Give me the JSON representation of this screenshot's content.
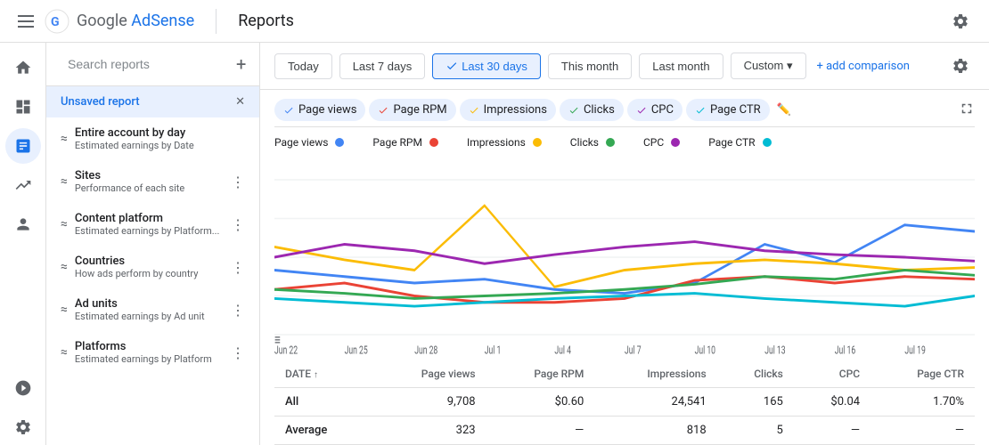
{
  "app": {
    "name": "Google AdSense",
    "logo_colors": [
      "#4285F4",
      "#EA4335",
      "#FBBC05",
      "#34A853"
    ],
    "page_title": "Reports"
  },
  "date_filters": {
    "options": [
      "Today",
      "Last 7 days",
      "Last 30 days",
      "This month",
      "Last month",
      "Custom"
    ],
    "active": "Last 30 days",
    "add_comparison_label": "+ add comparison",
    "custom_arrow": "▾"
  },
  "search": {
    "placeholder": "Search reports"
  },
  "reports_list": [
    {
      "id": "unsaved",
      "title": "Unsaved report",
      "sub": "",
      "active": true
    },
    {
      "id": "entire-account",
      "title": "Entire account by day",
      "sub": "Estimated earnings by Date",
      "active": false
    },
    {
      "id": "sites",
      "title": "Sites",
      "sub": "Performance of each site",
      "active": false
    },
    {
      "id": "content-platform",
      "title": "Content platform",
      "sub": "Estimated earnings by Platform...",
      "active": false
    },
    {
      "id": "countries",
      "title": "Countries",
      "sub": "How ads perform by country",
      "active": false
    },
    {
      "id": "ad-units",
      "title": "Ad units",
      "sub": "Estimated earnings by Ad unit",
      "active": false
    },
    {
      "id": "platforms",
      "title": "Platforms",
      "sub": "Estimated earnings by Platform",
      "active": false
    }
  ],
  "metric_tabs": [
    {
      "label": "Page views",
      "color": "#4285F4",
      "active": true
    },
    {
      "label": "Page RPM",
      "color": "#EA4335",
      "active": true
    },
    {
      "label": "Impressions",
      "color": "#FBBC05",
      "active": true
    },
    {
      "label": "Clicks",
      "color": "#34A853",
      "active": true
    },
    {
      "label": "CPC",
      "color": "#9C27B0",
      "active": true
    },
    {
      "label": "Page CTR",
      "color": "#00BCD4",
      "active": true
    }
  ],
  "chart": {
    "x_labels": [
      "Jun 22",
      "Jun 25",
      "Jun 28",
      "Jul 1",
      "Jul 4",
      "Jul 7",
      "Jul 10",
      "Jul 13",
      "Jul 16",
      "Jul 19"
    ],
    "series": {
      "page_views": {
        "color": "#4285F4",
        "values": [
          55,
          50,
          45,
          48,
          42,
          40,
          45,
          65,
          55,
          75
        ]
      },
      "page_rpm": {
        "color": "#EA4335",
        "values": [
          45,
          50,
          40,
          35,
          35,
          38,
          52,
          55,
          50,
          48
        ]
      },
      "impressions": {
        "color": "#FBBC05",
        "values": [
          75,
          65,
          55,
          90,
          45,
          55,
          60,
          65,
          60,
          55
        ]
      },
      "clicks": {
        "color": "#34A853",
        "values": [
          45,
          42,
          38,
          40,
          42,
          45,
          48,
          55,
          52,
          50
        ]
      },
      "cpc": {
        "color": "#9C27B0",
        "values": [
          60,
          70,
          65,
          55,
          62,
          68,
          72,
          65,
          62,
          58
        ]
      },
      "page_ctr": {
        "color": "#00BCD4",
        "values": [
          38,
          35,
          30,
          35,
          38,
          40,
          42,
          38,
          35,
          40
        ]
      }
    }
  },
  "table": {
    "columns": [
      "DATE",
      "Page views",
      "Page RPM",
      "Impressions",
      "Clicks",
      "CPC",
      "Page CTR"
    ],
    "rows": [
      {
        "label": "All",
        "page_views": "9,708",
        "page_rpm": "$0.60",
        "impressions": "24,541",
        "clicks": "165",
        "cpc": "$0.04",
        "page_ctr": "1.70%"
      },
      {
        "label": "Average",
        "page_views": "323",
        "page_rpm": "—",
        "impressions": "818",
        "clicks": "5",
        "cpc": "—",
        "page_ctr": "—"
      }
    ]
  }
}
